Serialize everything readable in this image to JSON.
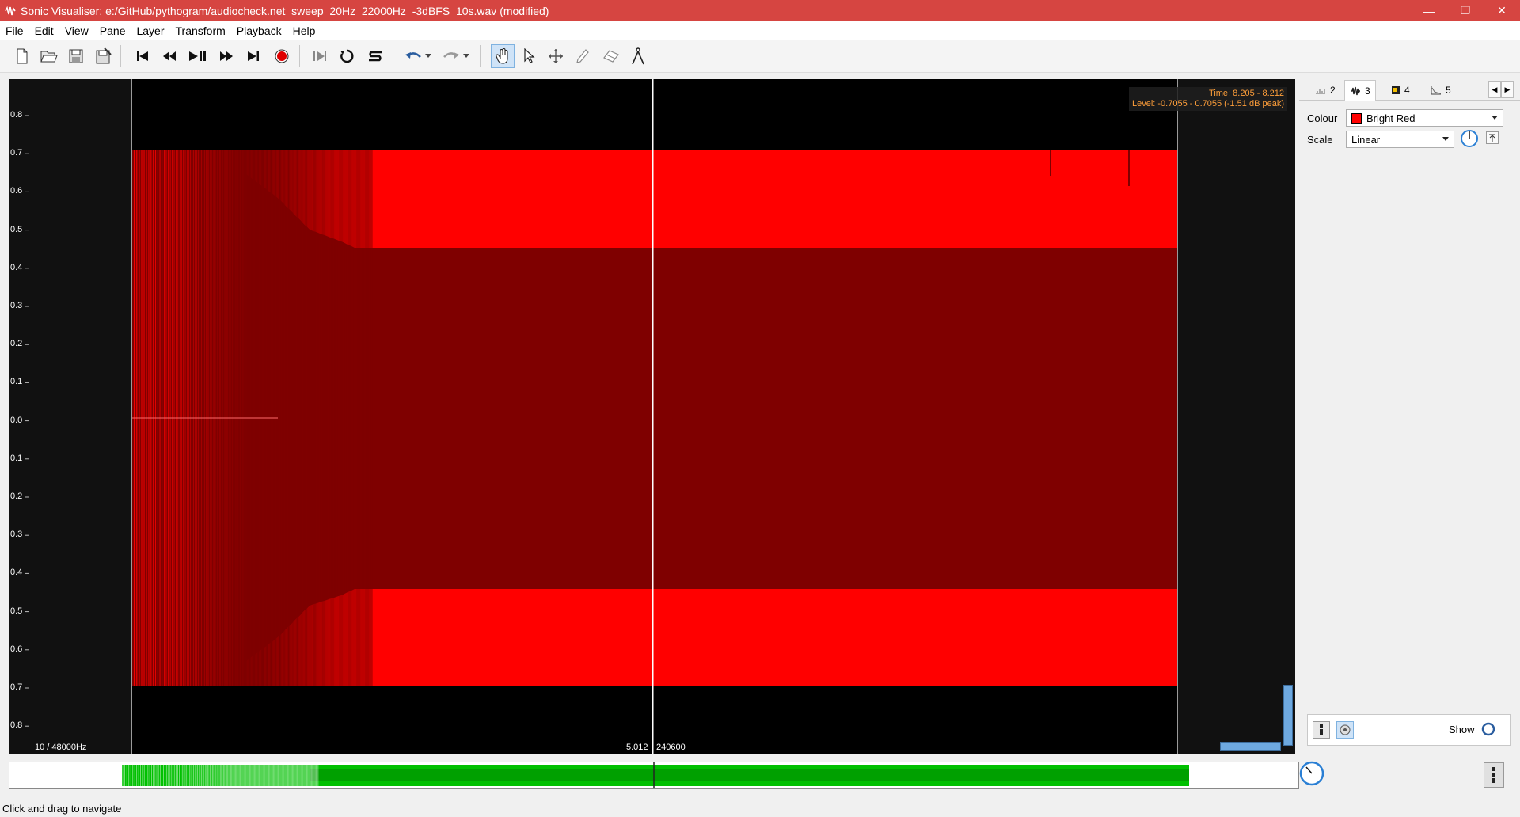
{
  "window": {
    "title": "Sonic Visualiser: e:/GitHub/pythogram/audiocheck.net_sweep_20Hz_22000Hz_-3dBFS_10s.wav (modified)",
    "minimize": "—",
    "restore": "❐",
    "close": "✕"
  },
  "menu": [
    "File",
    "Edit",
    "View",
    "Pane",
    "Layer",
    "Transform",
    "Playback",
    "Help"
  ],
  "toolbar": {
    "icons": [
      "new-file-icon",
      "open-file-icon",
      "save-icon",
      "save-session-icon",
      "rewind-start-icon",
      "rewind-icon",
      "play-pause-icon",
      "fast-forward-icon",
      "forward-end-icon",
      "record-icon",
      "play-selection-icon",
      "loop-icon",
      "solo-icon",
      "undo-icon",
      "redo-icon",
      "navigate-tool-icon",
      "select-tool-icon",
      "move-tool-icon",
      "draw-tool-icon",
      "erase-tool-icon",
      "measure-tool-icon"
    ],
    "active_tool": "navigate"
  },
  "pane": {
    "overlay_time": "Time: 8.205 - 8.212",
    "overlay_level": "Level: -0.7055 - 0.7055 (-1.51 dB peak)",
    "scale_labels": [
      "0.8",
      "0.7",
      "0.6",
      "0.5",
      "0.4",
      "0.3",
      "0.2",
      "0.1",
      "0.0",
      "0.1",
      "0.2",
      "0.3",
      "0.4",
      "0.5",
      "0.6",
      "0.7",
      "0.8"
    ],
    "zoom_label": "10 / 48000Hz",
    "cursor_time": "5.012",
    "cursor_frame": "240600",
    "colors": {
      "waveform_light": "#ff0000",
      "waveform_dark": "#7f0000",
      "background": "#000000"
    }
  },
  "properties": {
    "tabs": [
      {
        "label": "2",
        "icon": "ruler-icon"
      },
      {
        "label": "3",
        "icon": "waveform-icon"
      },
      {
        "label": "4",
        "icon": "colour-3d-icon"
      },
      {
        "label": "5",
        "icon": "spectrum-icon"
      }
    ],
    "active_tab": "3",
    "colour_label": "Colour",
    "colour_value": "Bright Red",
    "scale_label": "Scale",
    "scale_value": "Linear",
    "show_label": "Show"
  },
  "overview": {
    "colors": {
      "waveform": "#00c000"
    }
  },
  "status": {
    "text": "Click and drag to navigate"
  }
}
